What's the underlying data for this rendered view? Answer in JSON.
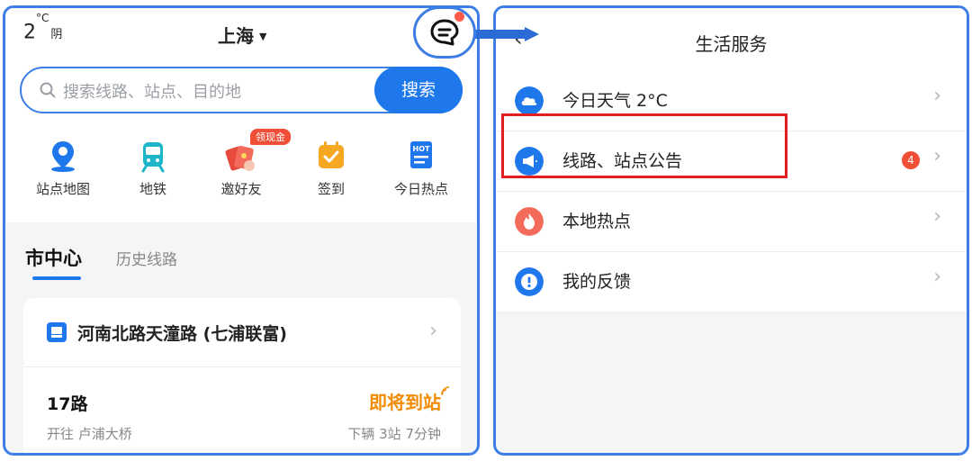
{
  "left": {
    "weather": {
      "temp": "2",
      "unit": "°C",
      "condition": "阴"
    },
    "city": "上海",
    "search": {
      "placeholder": "搜索线路、站点、目的地",
      "button": "搜索"
    },
    "quick_items": [
      {
        "label": "站点地图",
        "icon": "map-pin-icon"
      },
      {
        "label": "地铁",
        "icon": "metro-icon"
      },
      {
        "label": "邀好友",
        "icon": "red-envelope-icon",
        "promo": "领现金"
      },
      {
        "label": "签到",
        "icon": "checkin-calendar-icon"
      },
      {
        "label": "今日热点",
        "icon": "hot-news-icon",
        "icon_text": "HOT"
      }
    ],
    "tabs": {
      "active": "市中心",
      "other": "历史线路"
    },
    "stop": {
      "name": "河南北路天潼路 (七浦联富)"
    },
    "route": {
      "name": "17路",
      "status": "即将到站",
      "direction": "开往 卢浦大桥",
      "eta": "下辆 3站 7分钟"
    }
  },
  "right": {
    "title": "生活服务",
    "items": [
      {
        "label": "今日天气 2°C",
        "icon": "cloud-icon",
        "color": "#1f77ec"
      },
      {
        "label": "线路、站点公告",
        "icon": "megaphone-icon",
        "color": "#1f77ec",
        "badge": "4"
      },
      {
        "label": "本地热点",
        "icon": "flame-icon",
        "color": "#f26b5b"
      },
      {
        "label": "我的反馈",
        "icon": "feedback-icon",
        "color": "#1f77ec"
      }
    ]
  },
  "colors": {
    "accent": "#1f77ec",
    "orange": "#f28b00",
    "alert": "#f04e37",
    "highlight": "#e02020"
  }
}
